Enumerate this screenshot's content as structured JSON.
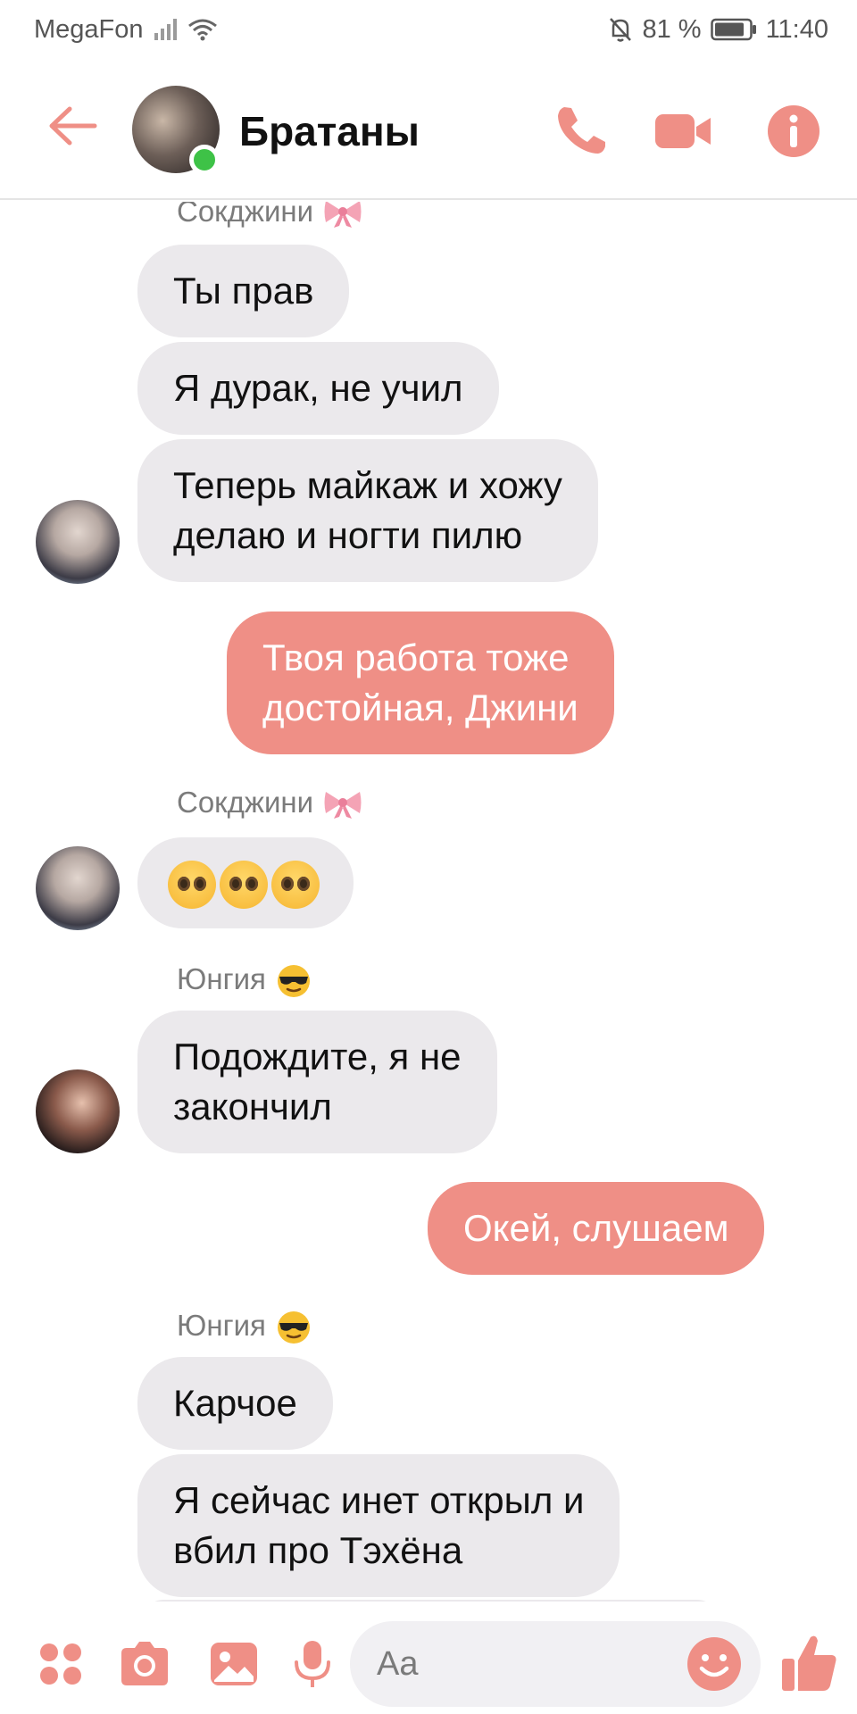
{
  "status_bar": {
    "carrier": "MegaFon",
    "battery": "81 %",
    "time": "11:40"
  },
  "header": {
    "title": "Братаны",
    "online": true
  },
  "messages": [
    {
      "sender": "Сокджини",
      "sender_emoji": "ribbon-emoji"
    },
    {
      "text": "Ты прав",
      "direction": "in"
    },
    {
      "text": "Я дурак, не учил",
      "direction": "in"
    },
    {
      "lines": [
        "Теперь майкаж и хожу",
        "делаю и ногти пилю"
      ],
      "direction": "in",
      "avatar": "jin"
    },
    {
      "lines": [
        "Твоя работа тоже",
        "достойная, Джини"
      ],
      "direction": "out"
    },
    {
      "sender": "Сокджини",
      "sender_emoji": "ribbon-emoji"
    },
    {
      "emoji": [
        "pleading-face-emoji",
        "pleading-face-emoji",
        "pleading-face-emoji"
      ],
      "direction": "in",
      "avatar": "jin"
    },
    {
      "sender": "Юнгия",
      "sender_emoji": "sunglasses-emoji"
    },
    {
      "lines": [
        "Подождите, я не",
        "закончил"
      ],
      "direction": "in",
      "avatar": "yoongi"
    },
    {
      "text": "Окей, слушаем",
      "direction": "out"
    },
    {
      "sender": "Юнгия",
      "sender_emoji": "sunglasses-emoji"
    },
    {
      "text": "Карчое",
      "direction": "in"
    },
    {
      "lines": [
        "Я сейчас инет открыл и",
        "вбил про Тэхёна"
      ],
      "direction": "in"
    }
  ],
  "composer": {
    "placeholder": "Aa"
  },
  "colors": {
    "accent": "#ef8f86",
    "incoming_bubble": "#ebe9ec",
    "online": "#3ec247"
  }
}
